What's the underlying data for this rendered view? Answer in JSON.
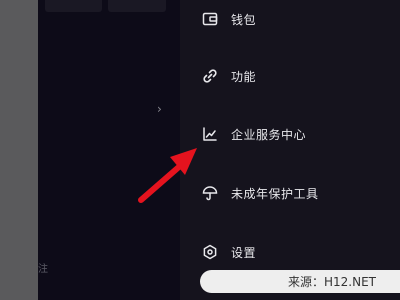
{
  "background": {
    "chevron": "›",
    "bottom_glyph": "注"
  },
  "menu": {
    "items": [
      {
        "label": "钱包",
        "icon": "wallet-icon"
      },
      {
        "label": "功能",
        "icon": "link-icon"
      },
      {
        "label": "企业服务中心",
        "icon": "chart-line-icon"
      },
      {
        "label": "未成年保护工具",
        "icon": "umbrella-icon"
      },
      {
        "label": "设置",
        "icon": "settings-hexagon-icon"
      }
    ]
  },
  "annotation": {
    "arrow_color": "#e5131e"
  },
  "watermark": {
    "text": "来源：H12.NET"
  },
  "colors": {
    "panel_bg": "#15131d",
    "page_bg": "#0c0a14",
    "text": "#e8e8ec"
  }
}
